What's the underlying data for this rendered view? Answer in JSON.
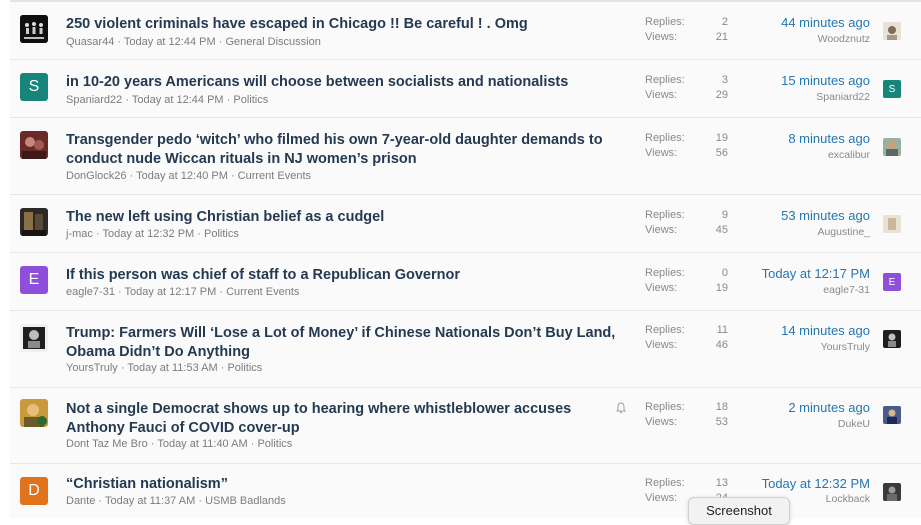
{
  "threads": [
    {
      "title": "250 violent criminals have escaped in Chicago !! Be careful ! . Omg",
      "author": "Quasar44",
      "time": "Today at 12:44 PM",
      "forum": "General Discussion",
      "replies_label": "Replies:",
      "replies": "2",
      "views_label": "Views:",
      "views": "21",
      "last_time": "44 minutes ago",
      "last_user": "Woodznutz"
    },
    {
      "title": "in 10-20 years Americans will choose between socialists and nationalists",
      "author": "Spaniard22",
      "time": "Today at 12:44 PM",
      "forum": "Politics",
      "avatar_letter": "S",
      "replies_label": "Replies:",
      "replies": "3",
      "views_label": "Views:",
      "views": "29",
      "last_time": "15 minutes ago",
      "last_user": "Spaniard22",
      "last_avatar_letter": "S"
    },
    {
      "title": "Transgender pedo ‘witch’ who filmed his own 7-year-old daughter demands to conduct nude Wiccan rituals in NJ women’s prison",
      "author": "DonGlock26",
      "time": "Today at 12:40 PM",
      "forum": "Current Events",
      "replies_label": "Replies:",
      "replies": "19",
      "views_label": "Views:",
      "views": "56",
      "last_time": "8 minutes ago",
      "last_user": "excalibur"
    },
    {
      "title": "The new left using Christian belief as a cudgel",
      "author": "j-mac",
      "time": "Today at 12:32 PM",
      "forum": "Politics",
      "replies_label": "Replies:",
      "replies": "9",
      "views_label": "Views:",
      "views": "45",
      "last_time": "53 minutes ago",
      "last_user": "Augustine_"
    },
    {
      "title": "If this person was chief of staff to a Republican Governor",
      "author": "eagle7-31",
      "time": "Today at 12:17 PM",
      "forum": "Current Events",
      "avatar_letter": "E",
      "replies_label": "Replies:",
      "replies": "0",
      "views_label": "Views:",
      "views": "19",
      "last_time": "Today at 12:17 PM",
      "last_user": "eagle7-31",
      "last_avatar_letter": "E"
    },
    {
      "title": "Trump: Farmers Will ‘Lose a Lot of Money’ if Chinese Nationals Don’t Buy Land, Obama Didn’t Do Anything",
      "author": "YoursTruly",
      "time": "Today at 11:53 AM",
      "forum": "Politics",
      "replies_label": "Replies:",
      "replies": "11",
      "views_label": "Views:",
      "views": "46",
      "last_time": "14 minutes ago",
      "last_user": "YoursTruly"
    },
    {
      "title": "Not a single Democrat shows up to hearing where whistleblower accuses Anthony Fauci of COVID cover-up",
      "author": "Dont Taz Me Bro",
      "time": "Today at 11:40 AM",
      "forum": "Politics",
      "replies_label": "Replies:",
      "replies": "18",
      "views_label": "Views:",
      "views": "53",
      "last_time": "2 minutes ago",
      "last_user": "DukeU"
    },
    {
      "title": "“Christian nationalism”",
      "author": "Dante",
      "time": "Today at 11:37 AM",
      "forum": "USMB Badlands",
      "avatar_letter": "D",
      "replies_label": "Replies:",
      "replies": "13",
      "views_label": "Views:",
      "views": "24",
      "last_time": "Today at 12:32 PM",
      "last_user": "Lockback"
    }
  ],
  "meta_separator": "·",
  "colors": {
    "title": "#243a52",
    "link": "#2577b1",
    "meta": "#7c7c7c",
    "avatar_s": "#18857a",
    "avatar_e": "#8e4fdb",
    "avatar_d": "#e0741c"
  },
  "icons": {
    "watch": "bell-icon"
  },
  "screenshot_button": "Screenshot"
}
